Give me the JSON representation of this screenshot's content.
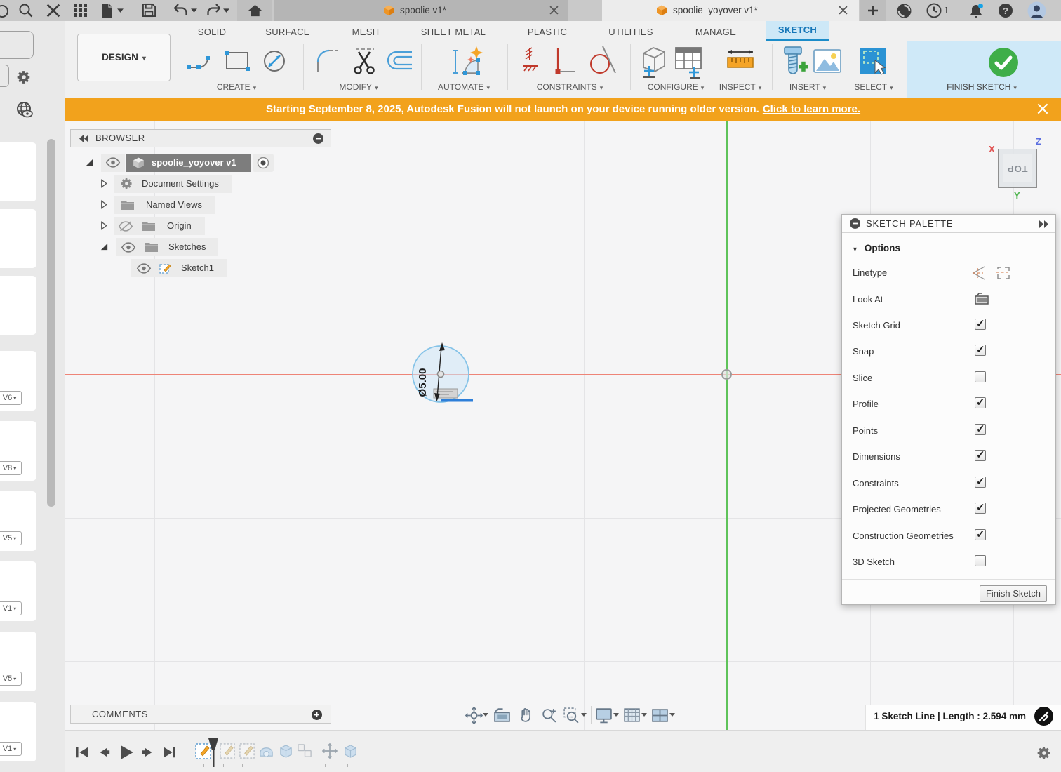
{
  "window": {
    "tabs": [
      {
        "title": "spoolie v1*"
      },
      {
        "title": "spoolie_yoyover v1*"
      }
    ],
    "history_badge": "1",
    "design_mode": "DESIGN"
  },
  "ribbon": {
    "tabs": [
      "SOLID",
      "SURFACE",
      "MESH",
      "SHEET METAL",
      "PLASTIC",
      "UTILITIES",
      "MANAGE",
      "SKETCH"
    ],
    "active_tab": "SKETCH",
    "groups": [
      "CREATE",
      "MODIFY",
      "AUTOMATE",
      "CONSTRAINTS",
      "CONFIGURE",
      "INSPECT",
      "INSERT",
      "SELECT"
    ],
    "finish_sketch": "FINISH SKETCH"
  },
  "banner": {
    "message": "Starting September 8, 2025, Autodesk Fusion will not launch on your device running older version.",
    "link": "Click to learn more.",
    "color": "#F2A21C"
  },
  "browser": {
    "title": "BROWSER",
    "root": "spoolie_yoyover v1",
    "items": [
      "Document Settings",
      "Named Views",
      "Origin",
      "Sketches"
    ],
    "sketch_item": "Sketch1"
  },
  "palette": {
    "title": "SKETCH PALETTE",
    "section": "Options",
    "rows": [
      {
        "label": "Linetype",
        "control": "icons"
      },
      {
        "label": "Look At",
        "control": "icon"
      },
      {
        "label": "Sketch Grid",
        "control": "checkbox",
        "checked": true
      },
      {
        "label": "Snap",
        "control": "checkbox",
        "checked": true
      },
      {
        "label": "Slice",
        "control": "checkbox",
        "checked": false
      },
      {
        "label": "Profile",
        "control": "checkbox",
        "checked": true
      },
      {
        "label": "Points",
        "control": "checkbox",
        "checked": true
      },
      {
        "label": "Dimensions",
        "control": "checkbox",
        "checked": true
      },
      {
        "label": "Constraints",
        "control": "checkbox",
        "checked": true
      },
      {
        "label": "Projected Geometries",
        "control": "checkbox",
        "checked": true
      },
      {
        "label": "Construction Geometries",
        "control": "checkbox",
        "checked": true
      },
      {
        "label": "3D Sketch",
        "control": "checkbox",
        "checked": false
      }
    ],
    "finish_button": "Finish Sketch"
  },
  "canvas": {
    "dimension": "Ø5.00",
    "viewcube": {
      "face": "TOP",
      "x": "X",
      "y": "Y",
      "z": "Z"
    }
  },
  "comments": {
    "title": "COMMENTS"
  },
  "status": {
    "text": "1 Sketch Line | Length : 2.594 mm"
  },
  "left_panel": {
    "versions": [
      "V6",
      "V8",
      "V5",
      "V1",
      "V5",
      "V1"
    ]
  }
}
